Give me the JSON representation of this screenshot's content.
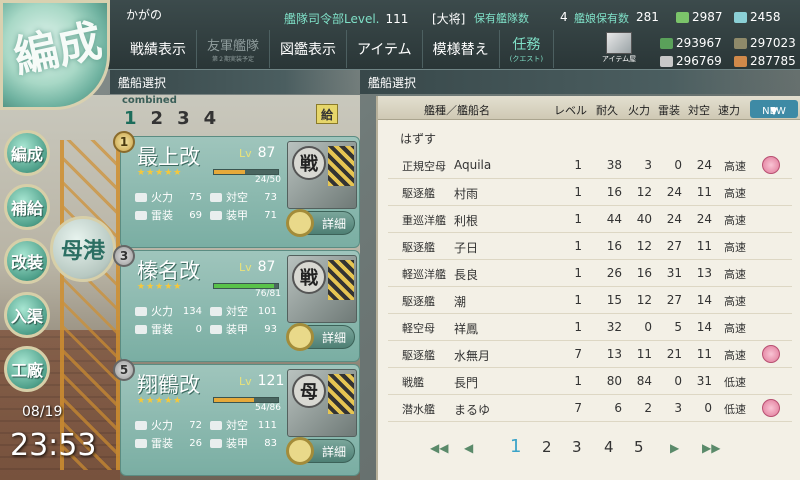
{
  "header": {
    "emblem": "編成",
    "admiral": "かがの",
    "hq_label": "艦隊司令部Level.",
    "hq_level": "111",
    "rank": "[大将]",
    "ships_label": "保有艦隊数",
    "ships_count": "4",
    "kanmusu_label": "艦娘保有数",
    "kanmusu_count": "281",
    "buckets": "2987",
    "devmat": "2458",
    "fuel": "293967",
    "ammo": "297023",
    "steel": "296769",
    "bauxite": "287785"
  },
  "menu": {
    "record": "戦績表示",
    "friend": "友軍艦隊",
    "friend_sub": "第２期実装予定",
    "library": "図鑑表示",
    "item": "アイテム",
    "remodel": "模様替え",
    "quest": "任務",
    "quest_sub": "(クエスト)",
    "shop": "アイテム屋"
  },
  "sections": {
    "left": "艦船選択",
    "right": "艦船選択"
  },
  "fleet": {
    "combined": "combined",
    "tabs": [
      "1",
      "2",
      "3",
      "4"
    ],
    "supply_badge": "給"
  },
  "cards": [
    {
      "num": "1",
      "name": "最上改",
      "lv_label": "Lv",
      "lv": "87",
      "hp": "24/50",
      "hp_ratio": 0.48,
      "hp_color": "#e6a93a",
      "fp": "75",
      "aa": "73",
      "tp": "69",
      "ar": "71",
      "badge": "戦",
      "detail": "詳細"
    },
    {
      "num": "3",
      "name": "榛名改",
      "lv_label": "Lv",
      "lv": "87",
      "hp": "76/81",
      "hp_ratio": 0.94,
      "hp_color": "#59c24a",
      "fp": "134",
      "aa": "101",
      "tp": "0",
      "ar": "93",
      "badge": "戦",
      "detail": "詳細"
    },
    {
      "num": "5",
      "name": "翔鶴改",
      "lv_label": "Lv",
      "lv": "121",
      "hp": "54/86",
      "hp_ratio": 0.63,
      "hp_color": "#e6a93a",
      "fp": "72",
      "aa": "111",
      "tp": "26",
      "ar": "83",
      "badge": "母",
      "detail": "詳細"
    }
  ],
  "stat_labels": {
    "fp": "火力",
    "aa": "対空",
    "tp": "雷装",
    "ar": "装甲"
  },
  "stars": "★★★★★",
  "nav": {
    "formation": "編成",
    "supply": "補給",
    "remodel": "改装",
    "dock": "入渠",
    "factory": "工廠",
    "port": "母港"
  },
  "clock": {
    "date": "08/19",
    "time": "23:53"
  },
  "table": {
    "head": {
      "type_name": "艦種／艦船名",
      "level": "レベル",
      "hp": "耐久",
      "fp": "火力",
      "tp": "雷装",
      "aa": "対空",
      "speed": "速力",
      "sort": "NEW"
    },
    "remove": "はずす",
    "rows": [
      {
        "cls": "正規空母",
        "name": "Aquila",
        "lv": "1",
        "hp": "38",
        "fp": "3",
        "tp": "0",
        "aa": "24",
        "spd": "高速",
        "heart": true
      },
      {
        "cls": "駆逐艦",
        "name": "村雨",
        "lv": "1",
        "hp": "16",
        "fp": "12",
        "tp": "24",
        "aa": "11",
        "spd": "高速",
        "heart": false
      },
      {
        "cls": "重巡洋艦",
        "name": "利根",
        "lv": "1",
        "hp": "44",
        "fp": "40",
        "tp": "24",
        "aa": "24",
        "spd": "高速",
        "heart": false
      },
      {
        "cls": "駆逐艦",
        "name": "子日",
        "lv": "1",
        "hp": "16",
        "fp": "12",
        "tp": "27",
        "aa": "11",
        "spd": "高速",
        "heart": false
      },
      {
        "cls": "軽巡洋艦",
        "name": "長良",
        "lv": "1",
        "hp": "26",
        "fp": "16",
        "tp": "31",
        "aa": "13",
        "spd": "高速",
        "heart": false
      },
      {
        "cls": "駆逐艦",
        "name": "潮",
        "lv": "1",
        "hp": "15",
        "fp": "12",
        "tp": "27",
        "aa": "14",
        "spd": "高速",
        "heart": false
      },
      {
        "cls": "軽空母",
        "name": "祥鳳",
        "lv": "1",
        "hp": "32",
        "fp": "0",
        "tp": "5",
        "aa": "14",
        "spd": "高速",
        "heart": false
      },
      {
        "cls": "駆逐艦",
        "name": "水無月",
        "lv": "7",
        "hp": "13",
        "fp": "11",
        "tp": "21",
        "aa": "11",
        "spd": "高速",
        "heart": true
      },
      {
        "cls": "戦艦",
        "name": "長門",
        "lv": "1",
        "hp": "80",
        "fp": "84",
        "tp": "0",
        "aa": "31",
        "spd": "低速",
        "heart": false
      },
      {
        "cls": "潜水艦",
        "name": "まるゆ",
        "lv": "7",
        "hp": "6",
        "fp": "2",
        "tp": "3",
        "aa": "0",
        "spd": "低速",
        "heart": true
      }
    ],
    "pages": [
      "1",
      "2",
      "3",
      "4",
      "5"
    ]
  }
}
